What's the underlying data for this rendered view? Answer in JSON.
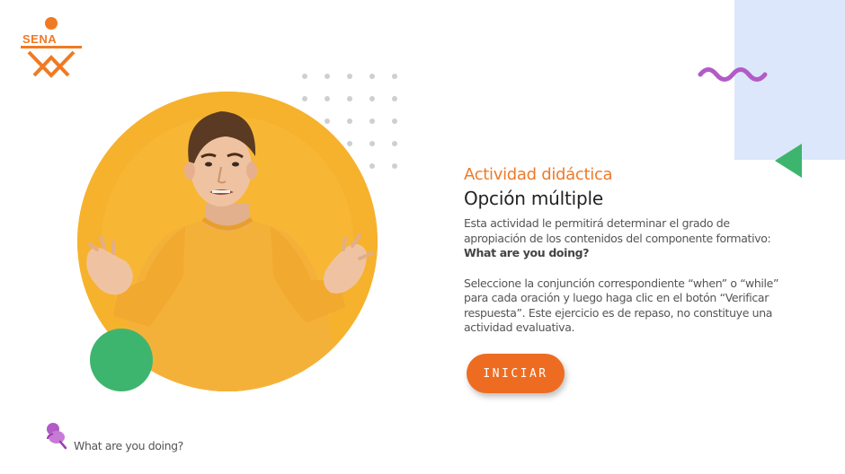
{
  "brand": {
    "logo_text": "SENA",
    "logo_color": "#f07a23"
  },
  "activity": {
    "kicker": "Actividad didáctica",
    "title": "Opción múltiple",
    "intro_text": "Esta actividad le permitirá determinar el grado de apropiación de los contenidos del componente formativo: ",
    "intro_bold": "What are you doing?",
    "instructions": "Seleccione la conjunción correspondiente “when” o “while” para cada oración y luego haga clic en el botón “Verificar respuesta”.  Este ejercicio es de repaso, no constituye una actividad evaluativa."
  },
  "start_button": {
    "label": "INICIAR"
  },
  "footer": {
    "label": "What are you doing?",
    "icon": "pushpin-icon"
  },
  "colors": {
    "accent_orange": "#ee6c21",
    "green": "#3db56f",
    "purple": "#b25bc6",
    "light_blue": "#dde7fb",
    "hero_yellow": "#f6b22d"
  }
}
